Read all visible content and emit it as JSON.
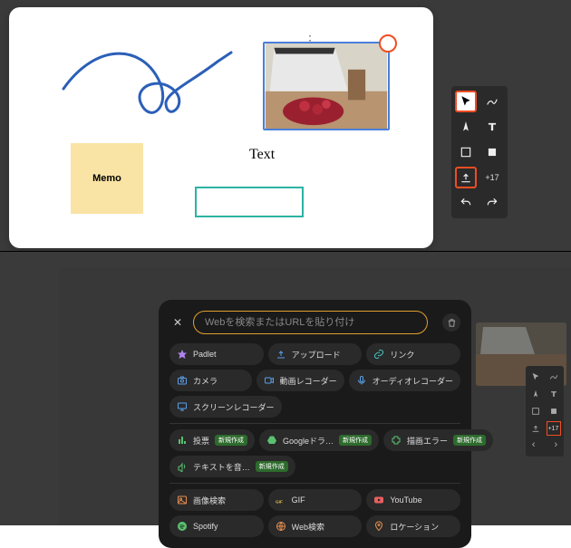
{
  "top": {
    "sticky_label": "Memo",
    "text_label": "Text",
    "plus_badge": "+17",
    "highlight_color": "#f04d22",
    "tools": [
      "cursor",
      "draw",
      "compass",
      "text",
      "shape",
      "fill",
      "upload",
      "plus17",
      "undo",
      "redo"
    ]
  },
  "bottom": {
    "search_placeholder": "Webを検索またはURLを貼り付け",
    "badge_text": "新規作成",
    "plus_badge": "+17",
    "options_row1": [
      {
        "icon": "padlet",
        "label": "Padlet",
        "color": "c-purple"
      },
      {
        "icon": "upload",
        "label": "アップロード",
        "color": "c-blue"
      },
      {
        "icon": "link",
        "label": "リンク",
        "color": "c-teal"
      }
    ],
    "options_row2": [
      {
        "icon": "camera",
        "label": "カメラ",
        "color": "c-blue"
      },
      {
        "icon": "video",
        "label": "動画レコーダー",
        "color": "c-blue"
      },
      {
        "icon": "audio",
        "label": "オーディオレコーダー",
        "color": "c-blue"
      }
    ],
    "options_row3": [
      {
        "icon": "screen",
        "label": "スクリーンレコーダー",
        "color": "c-blue"
      }
    ],
    "options_row4": [
      {
        "icon": "poll",
        "label": "投票",
        "color": "c-green",
        "badge": true
      },
      {
        "icon": "gdrive",
        "label": "Googleドラ…",
        "color": "c-green",
        "badge": true
      },
      {
        "icon": "puzzle",
        "label": "描画エラー",
        "color": "c-green",
        "badge": true
      }
    ],
    "options_row5": [
      {
        "icon": "t2s",
        "label": "テキストを音…",
        "color": "c-green",
        "badge": true
      }
    ],
    "options_row6": [
      {
        "icon": "image",
        "label": "画像検索",
        "color": "c-orange"
      },
      {
        "icon": "gif",
        "label": "GIF",
        "color": "c-yellow"
      },
      {
        "icon": "youtube",
        "label": "YouTube",
        "color": "c-red"
      }
    ],
    "options_row7": [
      {
        "icon": "spotify",
        "label": "Spotify",
        "color": "c-green"
      },
      {
        "icon": "web",
        "label": "Web検索",
        "color": "c-orange"
      },
      {
        "icon": "location",
        "label": "ロケーション",
        "color": "c-orange"
      }
    ]
  }
}
